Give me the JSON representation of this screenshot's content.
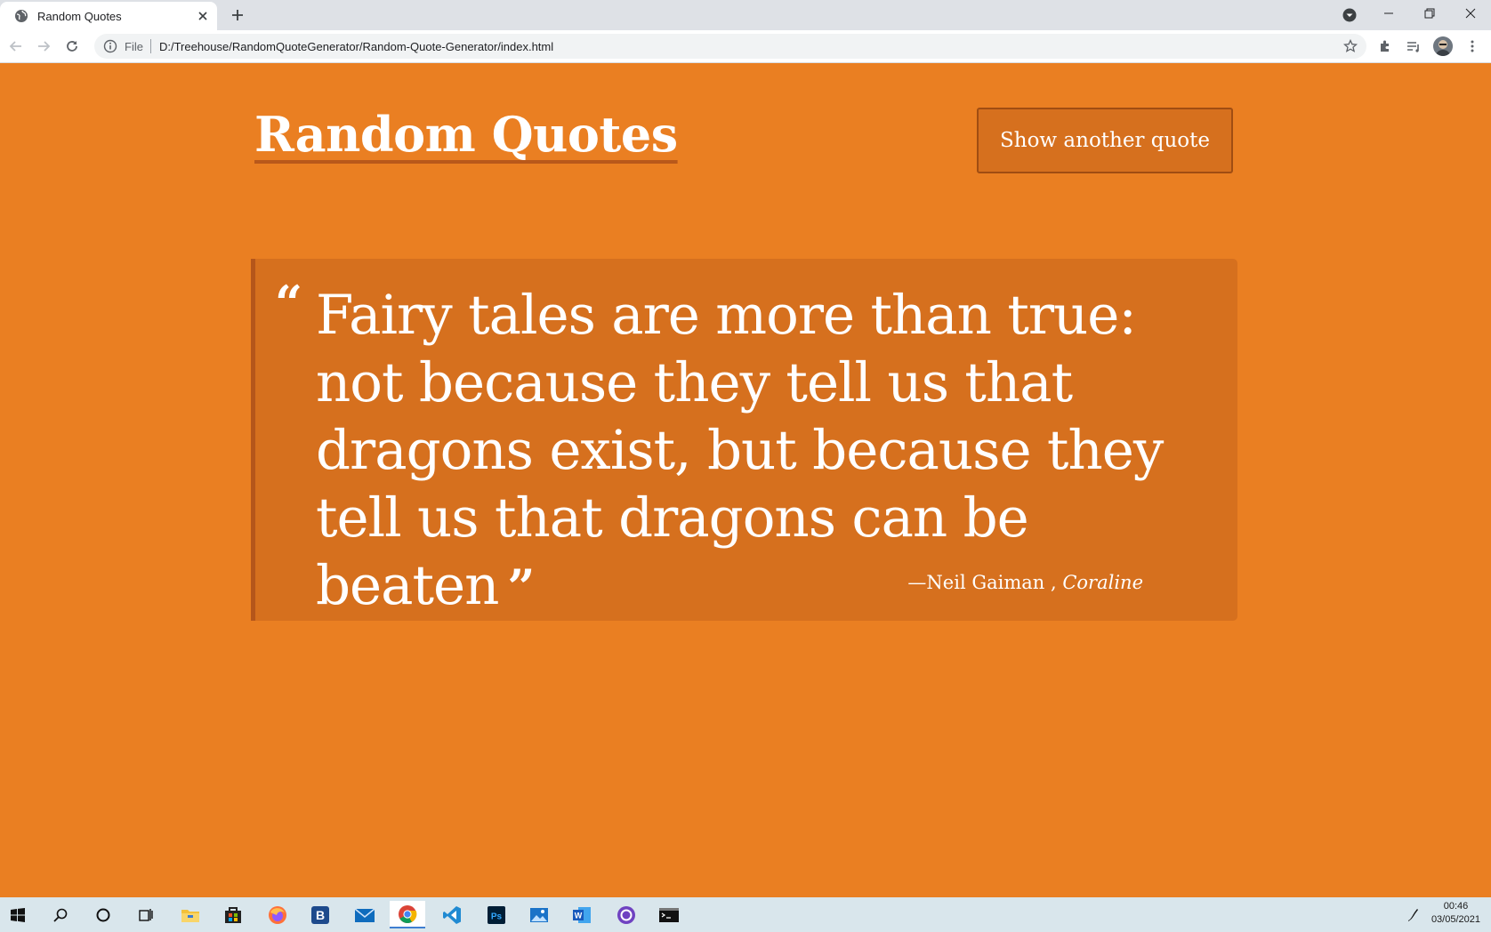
{
  "browser": {
    "tab_title": "Random Quotes",
    "url_chip": "File",
    "url": "D:/Treehouse/RandomQuoteGenerator/Random-Quote-Generator/index.html"
  },
  "page": {
    "title": "Random Quotes",
    "button_label": "Show another quote",
    "quote": {
      "open_mark": "“",
      "text": "Fairy tales are more than true: not because they tell us that dragons exist, but because they tell us that dragons can be beaten",
      "close_mark": "”",
      "source": "—Neil Gaiman",
      "separator": " , ",
      "citation": "Coraline"
    }
  },
  "taskbar": {
    "apps": [
      "windows-start",
      "search",
      "cortana",
      "task-view",
      "file-explorer",
      "store",
      "firefox",
      "b-app",
      "mail",
      "chrome",
      "vscode",
      "photoshop",
      "photos",
      "word",
      "github-desktop",
      "terminal"
    ],
    "time": "00:46",
    "date": "03/05/2021"
  },
  "colors": {
    "page_bg": "#ea7f22",
    "panel_bg": "#d6701e",
    "accent_border": "#b5561a"
  }
}
